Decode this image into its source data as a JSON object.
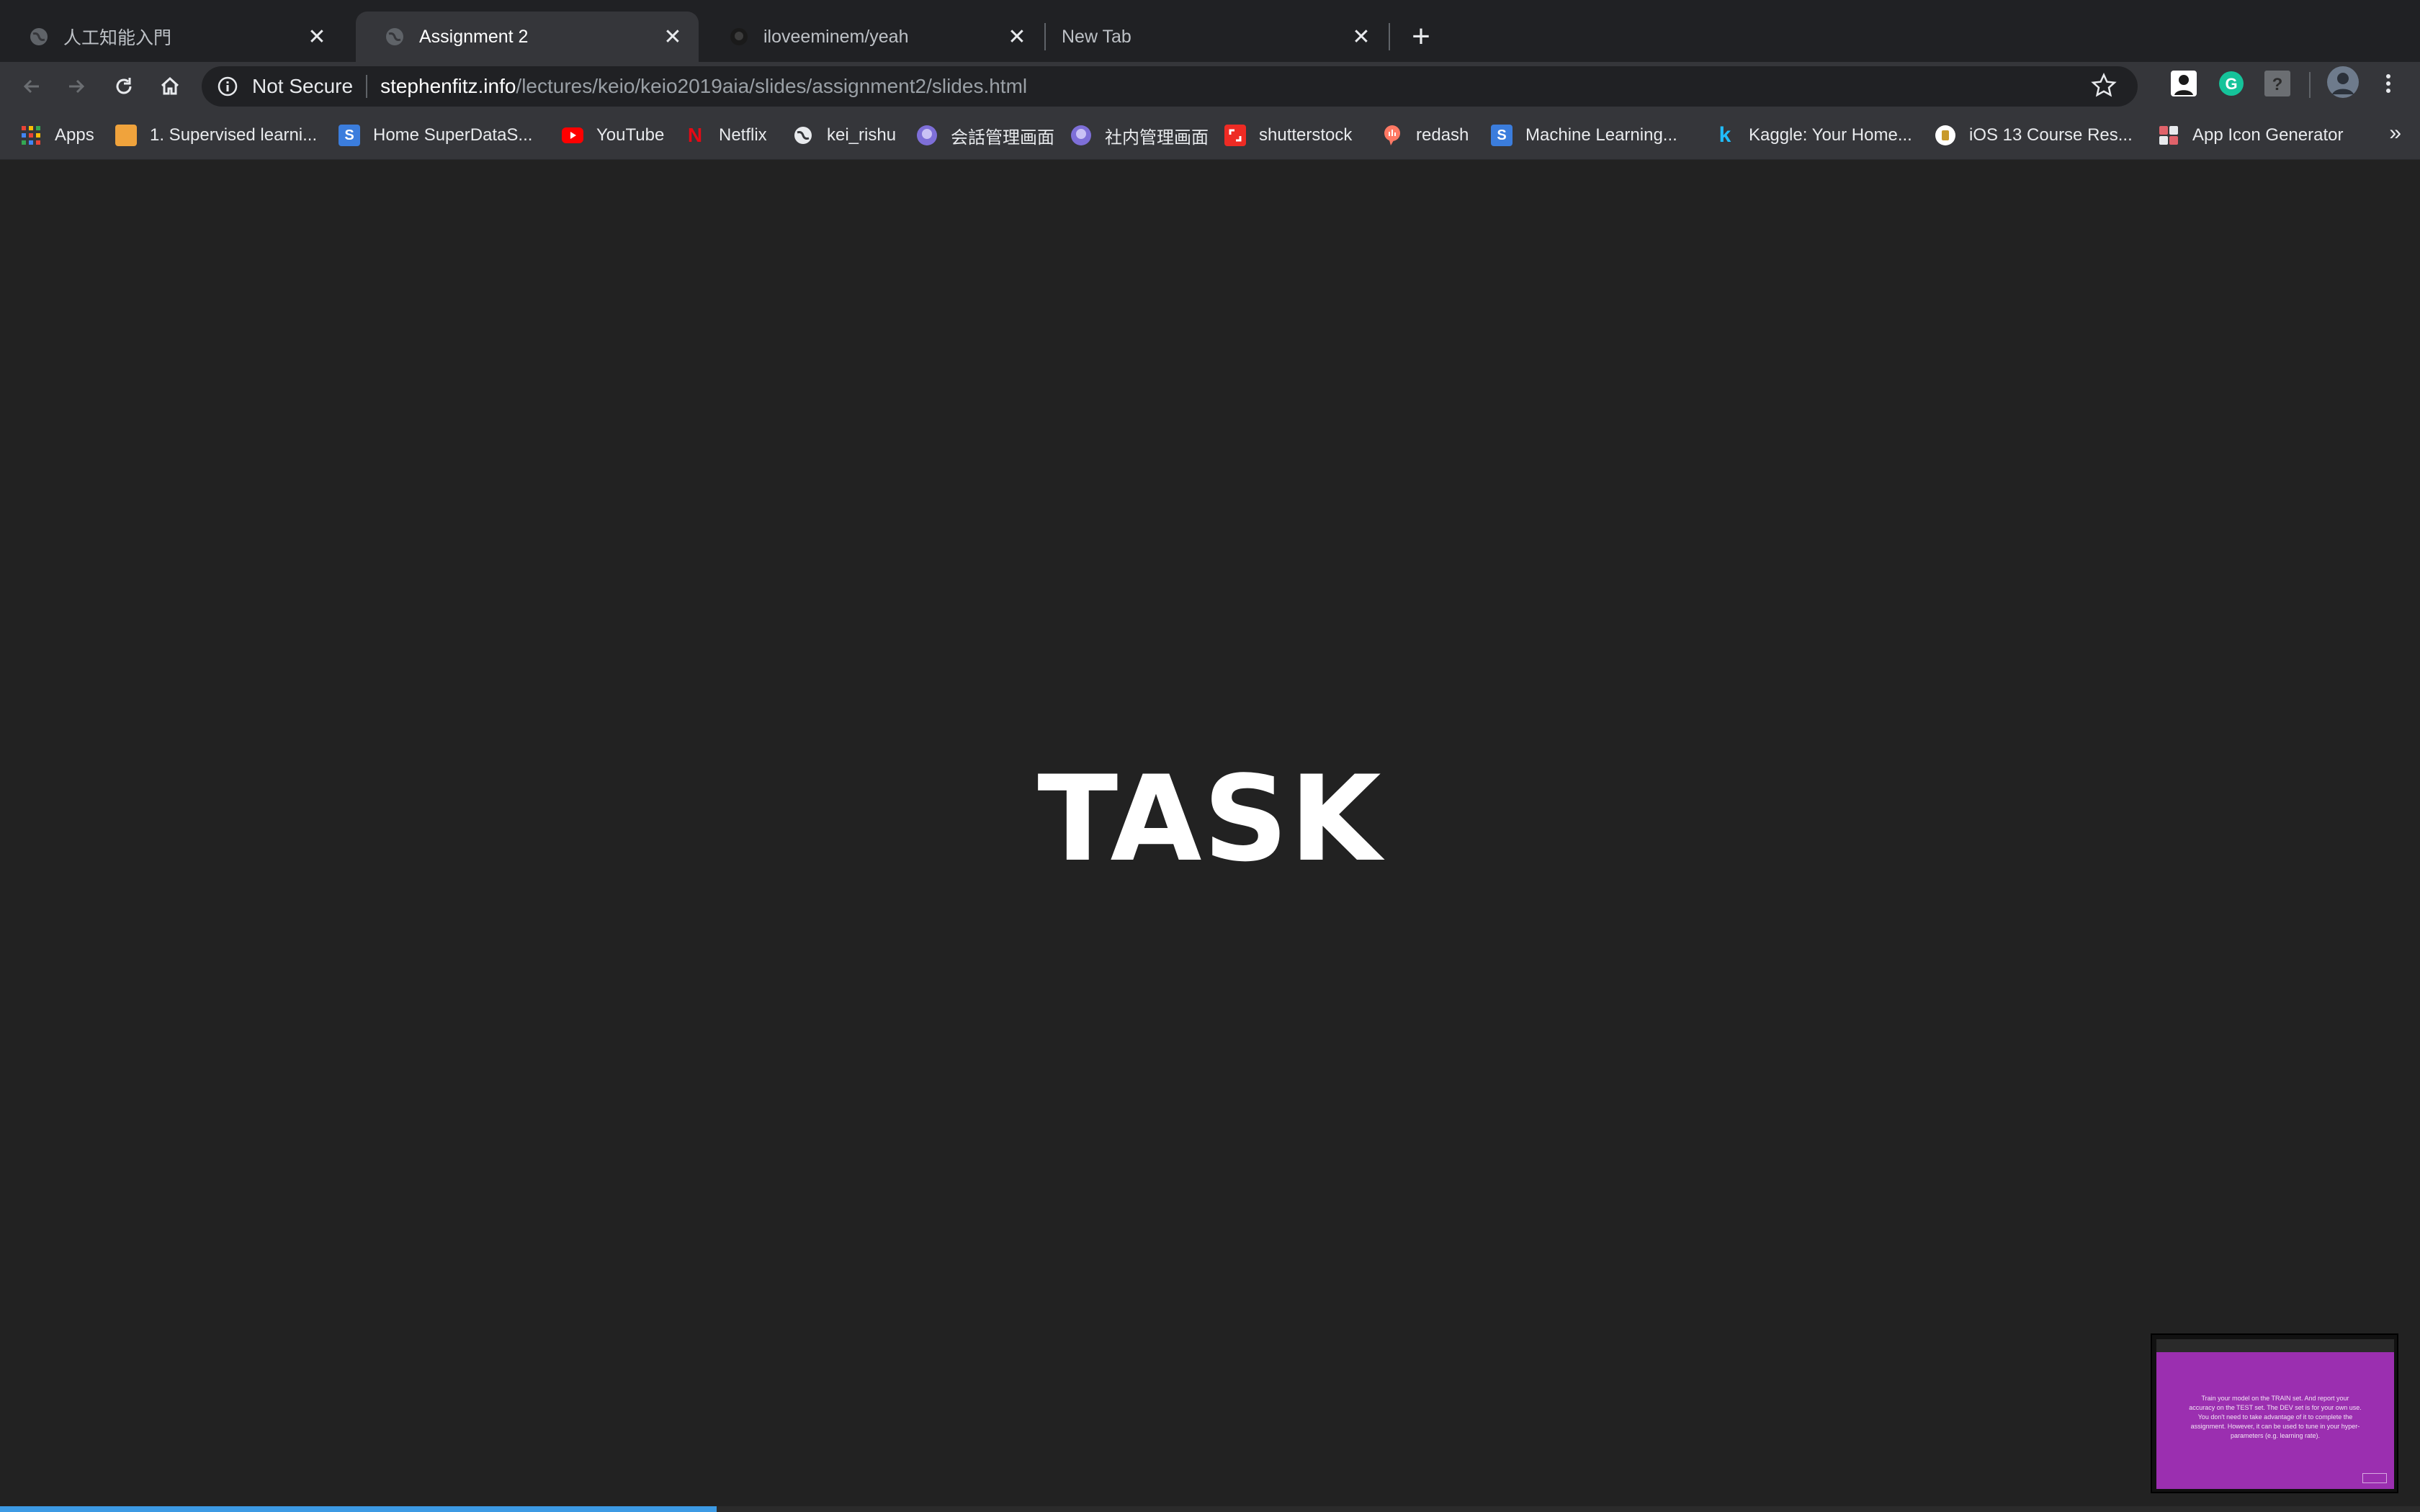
{
  "browser": {
    "tabs": [
      {
        "title": "人工知能入門",
        "favicon": "globe-icon",
        "active": false
      },
      {
        "title": "Assignment 2",
        "favicon": "globe-icon",
        "active": true
      },
      {
        "title": "iloveeminem/yeah",
        "favicon": "github-icon",
        "active": false
      },
      {
        "title": "New Tab",
        "favicon": "",
        "active": false
      }
    ],
    "new_tab_label": "+",
    "security_label": "Not Secure",
    "url_host": "stephenfitz.info",
    "url_path": "/lectures/keio/keio2019aia/slides/assignment2/slides.html"
  },
  "bookmarks": [
    {
      "label": "Apps",
      "icon": "apps-grid-icon"
    },
    {
      "label": "1. Supervised learni...",
      "icon": "ml-book-icon"
    },
    {
      "label": "Home SuperDataS...",
      "icon": "superdatascience-icon"
    },
    {
      "label": "YouTube",
      "icon": "youtube-icon"
    },
    {
      "label": "Netflix",
      "icon": "netflix-icon"
    },
    {
      "label": "kei_rishu",
      "icon": "globe-icon"
    },
    {
      "label": "会話管理画面",
      "icon": "bot-icon"
    },
    {
      "label": "社内管理画面",
      "icon": "bot-icon"
    },
    {
      "label": "shutterstock",
      "icon": "shutterstock-icon"
    },
    {
      "label": "redash",
      "icon": "redash-icon"
    },
    {
      "label": "Machine Learning...",
      "icon": "superdatascience-icon"
    },
    {
      "label": "Kaggle: Your Home...",
      "icon": "kaggle-icon"
    },
    {
      "label": "iOS 13 Course Res...",
      "icon": "course-icon"
    },
    {
      "label": "App Icon Generator",
      "icon": "app-icon-generator-icon"
    }
  ],
  "bookmarks_overflow": "»",
  "slide": {
    "title": "TASK",
    "progress": 0.296
  },
  "thumbnail": {
    "text": "Train your model on the TRAIN set. And report your accuracy on the TEST set. The DEV set is for your own use. You don't need to take advantage of it to complete the assignment. However, it can be used to tune in your hyper-parameters (e.g. learning rate)."
  }
}
